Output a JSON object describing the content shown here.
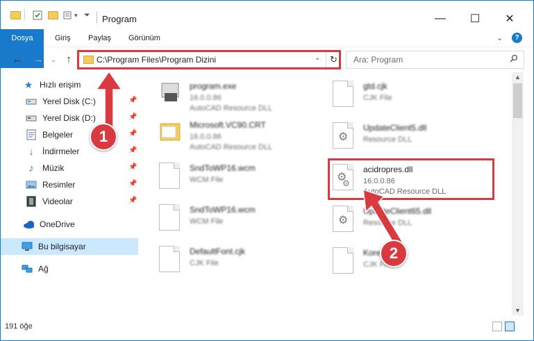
{
  "window": {
    "title": "Program",
    "controls": {
      "minimize": "—",
      "maximize": "☐",
      "close": "✕"
    }
  },
  "ribbon": {
    "tabs": [
      "Dosya",
      "Giriş",
      "Paylaş",
      "Görünüm"
    ]
  },
  "address_bar": {
    "path": "C:\\Program Files\\Program Dizini",
    "search_placeholder": "Ara: Program"
  },
  "sidebar": {
    "quick_access": "Hızlı erişim",
    "items": [
      {
        "label": "Yerel Disk (C:)",
        "icon": "drive-icon",
        "pinned": true
      },
      {
        "label": "Yerel Disk (D:)",
        "icon": "drive-icon",
        "pinned": true
      },
      {
        "label": "Belgeler",
        "icon": "documents-icon",
        "pinned": true
      },
      {
        "label": "İndirmeler",
        "icon": "downloads-icon",
        "pinned": true
      },
      {
        "label": "Müzik",
        "icon": "music-icon",
        "pinned": true
      },
      {
        "label": "Resimler",
        "icon": "pictures-icon",
        "pinned": true
      },
      {
        "label": "Videolar",
        "icon": "videos-icon",
        "pinned": true
      }
    ],
    "onedrive": "OneDrive",
    "this_pc": "Bu bilgisayar",
    "network": "Ağ"
  },
  "files": {
    "left": [
      {
        "name": "program.exe",
        "line2": "16.0.0.86",
        "line3": "AutoCAD   Resource DLL"
      },
      {
        "name": "Microsoft.VC90.CRT",
        "line2": "16.0.0.86",
        "line3": "AutoCAD   Resource DLL"
      },
      {
        "name": "SndToWP16.wcm",
        "line2": "WCM File",
        "line3": ""
      },
      {
        "name": "SndToWP16.wcm",
        "line2": "WCM File",
        "line3": ""
      },
      {
        "name": "DefaultFont.cjk",
        "line2": "CJK File",
        "line3": ""
      }
    ],
    "right": [
      {
        "name": "gtd.cjk",
        "line2": "CJK File",
        "line3": ""
      },
      {
        "name": "UpdateClient5.dll",
        "line2": "Resource DLL",
        "line3": ""
      },
      {
        "name": "acidropres.dll",
        "line2": "16.0.0.86",
        "line3": "AutoCAD   Resource DLL"
      },
      {
        "name": "UpdateClient65.dll",
        "line2": "Resource DLL",
        "line3": ""
      },
      {
        "name": "Kore.dll",
        "line2": "CJK File",
        "line3": ""
      }
    ]
  },
  "status": {
    "item_count": "191 öğe"
  },
  "annotations": {
    "badge1": "1",
    "badge2": "2",
    "color": "#d93a3f"
  },
  "colors": {
    "accent": "#1979ca",
    "selected": "#cce8ff",
    "highlight": "#d93a3f"
  }
}
